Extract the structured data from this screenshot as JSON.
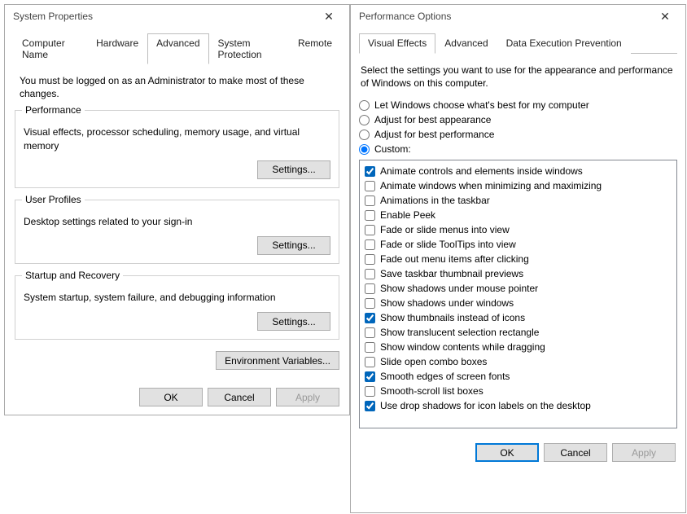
{
  "system_properties": {
    "title": "System Properties",
    "tabs": [
      "Computer Name",
      "Hardware",
      "Advanced",
      "System Protection",
      "Remote"
    ],
    "active_tab": 2,
    "instruction": "You must be logged on as an Administrator to make most of these changes.",
    "groups": {
      "performance": {
        "title": "Performance",
        "desc": "Visual effects, processor scheduling, memory usage, and virtual memory",
        "button": "Settings..."
      },
      "user_profiles": {
        "title": "User Profiles",
        "desc": "Desktop settings related to your sign-in",
        "button": "Settings..."
      },
      "startup": {
        "title": "Startup and Recovery",
        "desc": "System startup, system failure, and debugging information",
        "button": "Settings..."
      }
    },
    "env_button": "Environment Variables...",
    "buttons": {
      "ok": "OK",
      "cancel": "Cancel",
      "apply": "Apply"
    }
  },
  "performance_options": {
    "title": "Performance Options",
    "tabs": [
      "Visual Effects",
      "Advanced",
      "Data Execution Prevention"
    ],
    "active_tab": 0,
    "instruction": "Select the settings you want to use for the appearance and performance of Windows on this computer.",
    "radios": [
      {
        "label": "Let Windows choose what's best for my computer",
        "checked": false
      },
      {
        "label": "Adjust for best appearance",
        "checked": false
      },
      {
        "label": "Adjust for best performance",
        "checked": false
      },
      {
        "label": "Custom:",
        "checked": true
      }
    ],
    "checkboxes": [
      {
        "label": "Animate controls and elements inside windows",
        "checked": true
      },
      {
        "label": "Animate windows when minimizing and maximizing",
        "checked": false
      },
      {
        "label": "Animations in the taskbar",
        "checked": false
      },
      {
        "label": "Enable Peek",
        "checked": false
      },
      {
        "label": "Fade or slide menus into view",
        "checked": false
      },
      {
        "label": "Fade or slide ToolTips into view",
        "checked": false
      },
      {
        "label": "Fade out menu items after clicking",
        "checked": false
      },
      {
        "label": "Save taskbar thumbnail previews",
        "checked": false
      },
      {
        "label": "Show shadows under mouse pointer",
        "checked": false
      },
      {
        "label": "Show shadows under windows",
        "checked": false
      },
      {
        "label": "Show thumbnails instead of icons",
        "checked": true
      },
      {
        "label": "Show translucent selection rectangle",
        "checked": false
      },
      {
        "label": "Show window contents while dragging",
        "checked": false
      },
      {
        "label": "Slide open combo boxes",
        "checked": false
      },
      {
        "label": "Smooth edges of screen fonts",
        "checked": true
      },
      {
        "label": "Smooth-scroll list boxes",
        "checked": false
      },
      {
        "label": "Use drop shadows for icon labels on the desktop",
        "checked": true
      }
    ],
    "buttons": {
      "ok": "OK",
      "cancel": "Cancel",
      "apply": "Apply"
    }
  }
}
